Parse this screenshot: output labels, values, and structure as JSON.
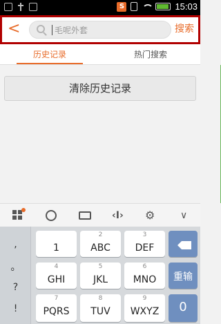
{
  "status_bar": {
    "time": "15:03",
    "left_icons": [
      "notification-icon",
      "usb-icon",
      "image-icon"
    ],
    "right_icons": [
      "app-badge-icon",
      "vibrate-icon",
      "wifi-icon",
      "battery-icon"
    ],
    "badge_text": "S"
  },
  "header": {
    "back_icon": "<",
    "search_placeholder": "毛呢外套",
    "search_button": "搜索"
  },
  "tabs": [
    {
      "label": "历史记录",
      "active": true
    },
    {
      "label": "热门搜索",
      "active": false
    }
  ],
  "clear_history_label": "清除历史记录",
  "keyboard": {
    "toolbar_icons": [
      "grid-icon",
      "emoji-icon",
      "keyboard-icon",
      "cursor-move-icon",
      "gear-icon",
      "chevron-down-icon"
    ],
    "symbol_column": [
      ",",
      "。",
      "?",
      "!"
    ],
    "keys": [
      {
        "num": "",
        "label": "1"
      },
      {
        "num": "2",
        "label": "ABC"
      },
      {
        "num": "3",
        "label": "DEF"
      },
      {
        "num": "4",
        "label": "GHI"
      },
      {
        "num": "5",
        "label": "JKL"
      },
      {
        "num": "6",
        "label": "MNO"
      },
      {
        "num": "7",
        "label": "PQRS"
      },
      {
        "num": "8",
        "label": "TUV"
      },
      {
        "num": "9",
        "label": "WXYZ"
      }
    ],
    "reenter_label": "重输",
    "zero_label": "0",
    "accent_color": "#6f8fbf"
  },
  "accent_color": "#e86b29"
}
